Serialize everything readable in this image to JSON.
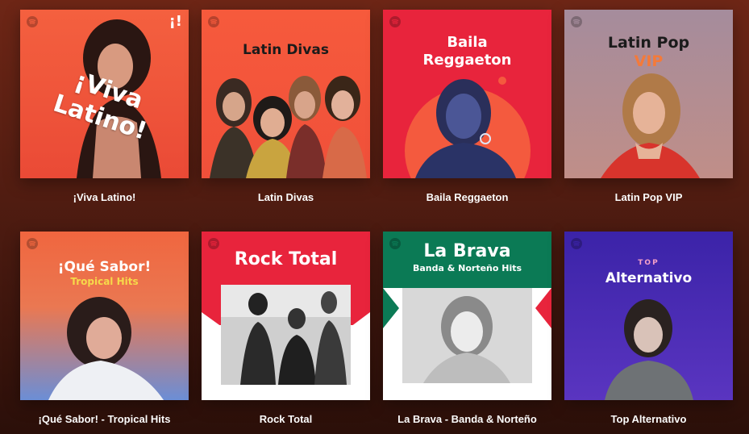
{
  "playlists": [
    {
      "title": "¡Viva Latino!",
      "cover_text": "¡Viva Latino!",
      "cover_badge": "¡!",
      "bg": "#f0563d"
    },
    {
      "title": "Latin Divas",
      "cover_text": "Latin Divas",
      "bg": "#f4563a"
    },
    {
      "title": "Baila Reggaeton",
      "cover_text_1": "Baila",
      "cover_text_2": "Reggaeton",
      "bg": "#e8243c"
    },
    {
      "title": "Latin Pop VIP",
      "cover_text_1": "Latin Pop",
      "cover_text_2": "VIP",
      "bg": "#a88a9a"
    },
    {
      "title": "¡Qué Sabor! - Tropical Hits",
      "cover_text_1": "¡Qué Sabor!",
      "cover_text_2": "Tropical Hits",
      "bg": "#f06a45"
    },
    {
      "title": "Rock Total",
      "cover_text": "Rock Total",
      "bg": "#e8243c"
    },
    {
      "title": "La Brava - Banda & Norteño",
      "cover_text_1": "La Brava",
      "cover_text_2": "Banda & Norteño Hits",
      "bg": "#0b7a55"
    },
    {
      "title": "Top Alternativo",
      "cover_text_1": "TOP",
      "cover_text_2": "Alternativo",
      "bg": "#4a2db0"
    }
  ],
  "icons": {
    "brand": "spotify-logo-icon"
  }
}
